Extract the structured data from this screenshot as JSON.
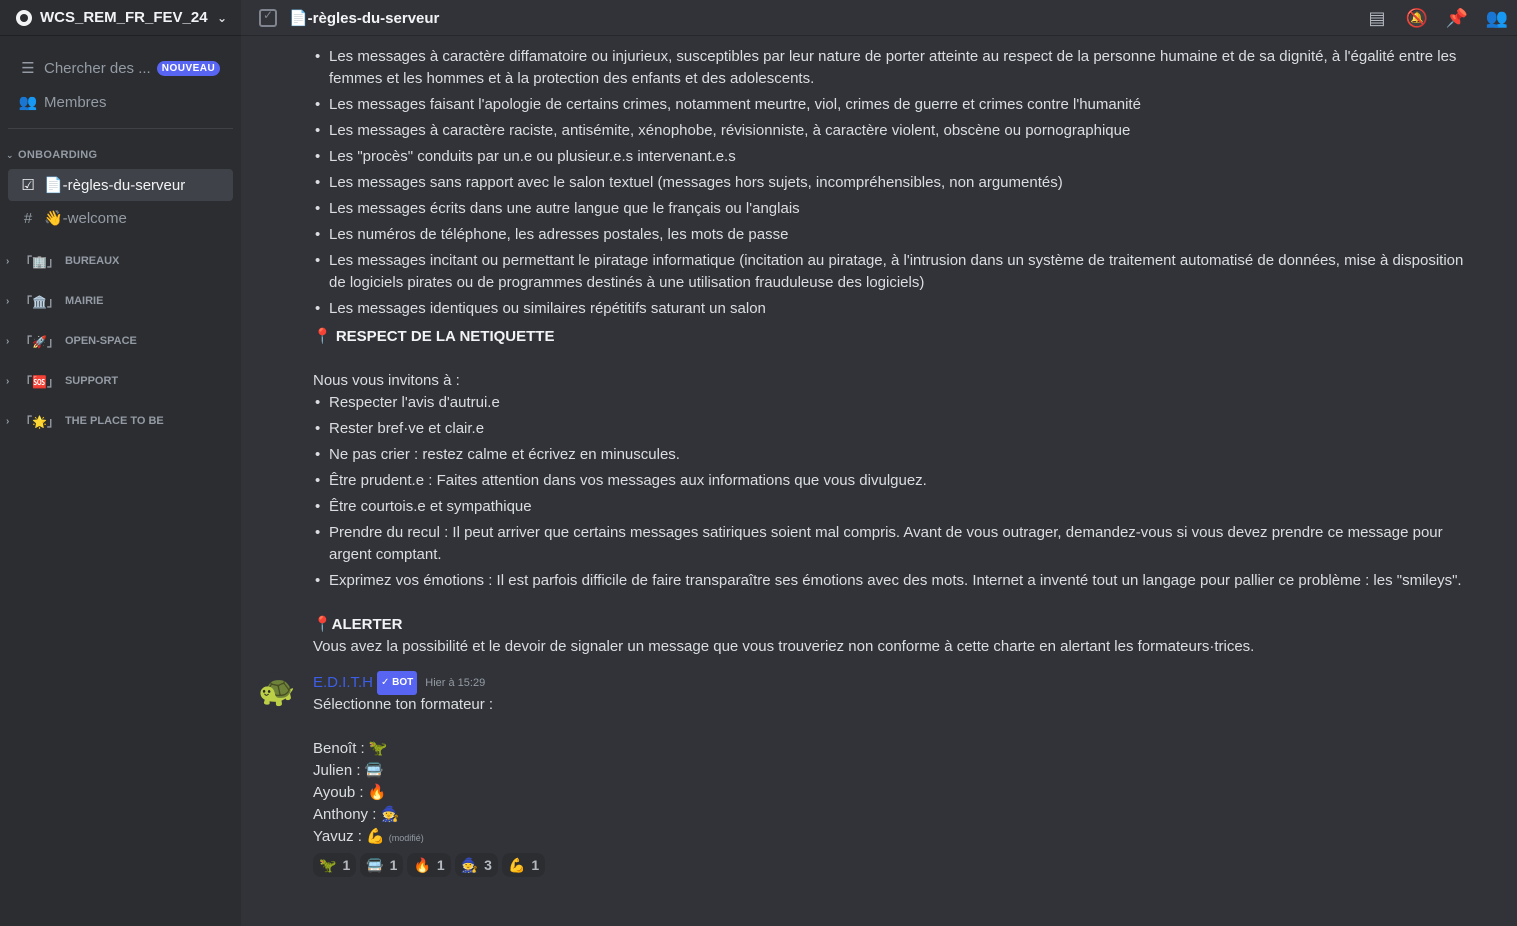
{
  "server": {
    "name": "WCS_REM_FR_FEV_24"
  },
  "sidebar": {
    "top_items": [
      {
        "label": "Chercher des ...",
        "badge": "NOUVEAU"
      },
      {
        "label": "Membres"
      }
    ],
    "category": "ONBOARDING",
    "channels": [
      {
        "label": "📄-règles-du-serveur"
      },
      {
        "label": "👋-welcome"
      }
    ],
    "collapsed_categories": [
      {
        "emoji": "「🏢」",
        "label": "BUREAUX"
      },
      {
        "emoji": "「🏛️」",
        "label": "MAIRIE"
      },
      {
        "emoji": "「🚀」",
        "label": "OPEN-SPACE"
      },
      {
        "emoji": "「🆘」",
        "label": "SUPPORT"
      },
      {
        "emoji": "「🌟」",
        "label": "THE PLACE TO BE"
      }
    ]
  },
  "topbar": {
    "channel": "📄-règles-du-serveur"
  },
  "content": {
    "rules_list": [
      "Les messages à caractère diffamatoire ou injurieux, susceptibles par leur nature de porter atteinte au respect de la personne humaine et de sa dignité, à l'égalité entre les femmes et les hommes et à la protection des enfants et des adolescents.",
      "Les messages faisant l'apologie de certains crimes, notamment meurtre, viol, crimes de guerre et crimes contre l'humanité",
      "Les messages à caractère raciste, antisémite, xénophobe, révisionniste, à caractère violent, obscène ou pornographique",
      "Les \"procès\" conduits par un.e ou plusieur.e.s intervenant.e.s",
      "Les messages sans rapport avec le salon textuel (messages hors sujets, incompréhensibles, non argumentés)",
      "Les messages écrits dans une autre langue que le français ou l'anglais",
      "Les numéros de téléphone, les adresses postales, les mots de passe",
      "Les messages incitant ou permettant le piratage informatique (incitation au piratage, à l'intrusion dans un système de traitement automatisé de données, mise à disposition de logiciels pirates ou de programmes destinés à une utilisation frauduleuse des logiciels)",
      "Les messages identiques ou similaires répétitifs saturant un salon"
    ],
    "netiquette_title": "📍 RESPECT DE LA NETIQUETTE",
    "netiquette_intro": "Nous vous invitons à :",
    "netiquette_list": [
      "Respecter l'avis d'autrui.e",
      "Rester bref·ve et clair.e",
      "Ne pas crier : restez calme et écrivez en minuscules.",
      "Être prudent.e : Faites attention dans vos messages aux informations que vous divulguez.",
      "Être courtois.e et sympathique",
      "Prendre du recul : Il peut arriver que certains messages satiriques soient mal compris. Avant de vous outrager, demandez-vous si vous devez prendre ce message pour argent comptant.",
      "Exprimez vos émotions : Il est parfois difficile de faire transparaître ses émotions avec des mots. Internet a inventé tout un langage pour pallier ce problème : les \"smileys\"."
    ],
    "alert_title": "📍ALERTER",
    "alert_text": "Vous avez la possibilité et le devoir de signaler un message que vous trouveriez non conforme à cette charte en alertant les formateurs·trices."
  },
  "message": {
    "avatar": "🐢",
    "author": "E.D.I.T.H",
    "bot_badge": "✓ BOT",
    "timestamp": "Hier à 15:29",
    "intro": "Sélectionne ton formateur :",
    "lines": [
      {
        "name": "Benoît :",
        "emoji": "🦖"
      },
      {
        "name": "Julien :",
        "emoji": "🚍"
      },
      {
        "name": "Ayoub :",
        "emoji": "🔥"
      },
      {
        "name": "Anthony :",
        "emoji": "🧙"
      },
      {
        "name": "Yavuz :",
        "emoji": "💪"
      }
    ],
    "edited": "(modifié)",
    "reactions": [
      {
        "emoji": "🦖",
        "count": "1"
      },
      {
        "emoji": "🚍",
        "count": "1"
      },
      {
        "emoji": "🔥",
        "count": "1"
      },
      {
        "emoji": "🧙",
        "count": "3"
      },
      {
        "emoji": "💪",
        "count": "1"
      }
    ]
  }
}
